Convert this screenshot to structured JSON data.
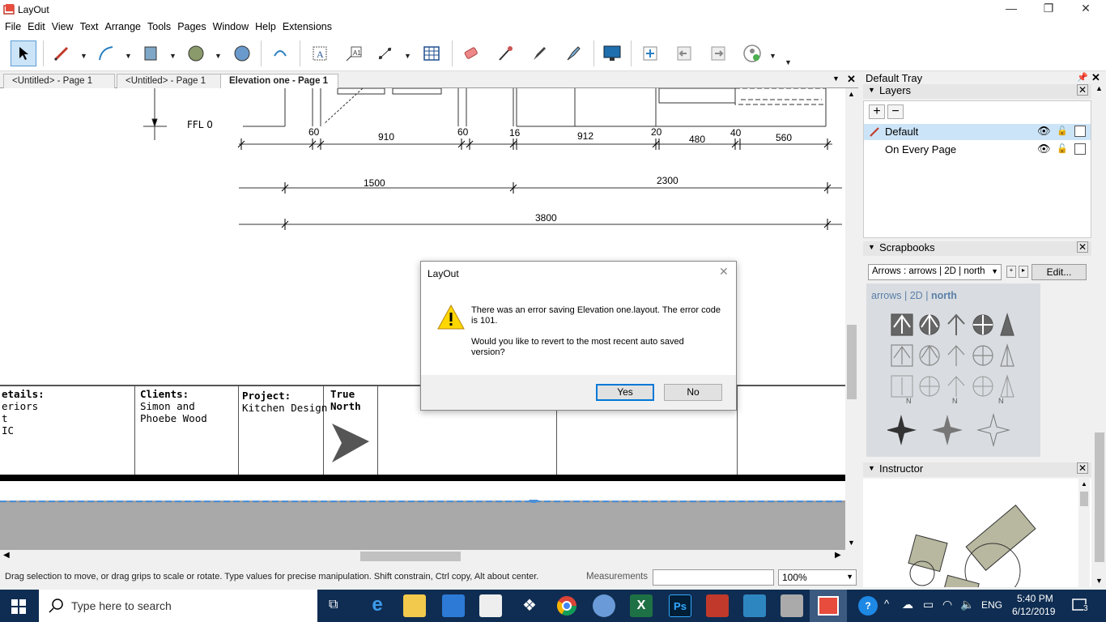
{
  "window": {
    "title": "LayOut",
    "minimize": "—",
    "restore": "❐",
    "close": "✕"
  },
  "menu": [
    "File",
    "Edit",
    "View",
    "Text",
    "Arrange",
    "Tools",
    "Pages",
    "Window",
    "Help",
    "Extensions"
  ],
  "tabs": [
    {
      "label": "<Untitled> - Page 1",
      "active": false
    },
    {
      "label": "<Untitled> - Page 1",
      "active": false
    },
    {
      "label": "Elevation one - Page 1",
      "active": true
    }
  ],
  "drawing": {
    "ffl_label": "FFL 0",
    "dims_row1": [
      "60",
      "910",
      "60",
      "16",
      "912",
      "20",
      "480",
      "40",
      "560"
    ],
    "dims_row2": [
      "1500",
      "2300"
    ],
    "dims_row3": [
      "3800"
    ]
  },
  "titleblock": {
    "details_label": "etails:",
    "details_lines": [
      "eriors",
      "t",
      "IC"
    ],
    "clients_label": "Clients:",
    "clients_lines": [
      "Simon and",
      "Phoebe Wood"
    ],
    "project_label": "Project:",
    "project_value": "Kitchen Design",
    "north_label_1": "True",
    "north_label_2": "North"
  },
  "status": {
    "hint": "Drag selection to move, or drag grips to scale or rotate. Type values for precise manipulation. Shift constrain, Ctrl copy, Alt about center.",
    "measurements_label": "Measurements",
    "measurements_value": "",
    "zoom": "100%"
  },
  "tray": {
    "title": "Default Tray",
    "layers": {
      "header": "Layers",
      "add": "+",
      "remove": "−",
      "items": [
        "Default",
        "On Every Page"
      ]
    },
    "scrapbooks": {
      "header": "Scrapbooks",
      "selected": "Arrows : arrows | 2D | north",
      "edit_label": "Edit...",
      "crumb_1": "arrows",
      "crumb_2": "2D",
      "crumb_3": "north",
      "sep": "|",
      "compass_n": "N"
    },
    "instructor": {
      "header": "Instructor"
    }
  },
  "dialog": {
    "title": "LayOut",
    "message_1": "There was an error saving Elevation one.layout. The error code is 101.",
    "message_2": "Would you like to revert to the most recent auto saved version?",
    "yes": "Yes",
    "no": "No"
  },
  "taskbar": {
    "search_placeholder": "Type here to search",
    "lang": "ENG",
    "time": "5:40 PM",
    "date": "6/12/2019",
    "notifications": "3"
  },
  "colors": {
    "accent": "#0078d7",
    "taskbar": "#0f2d52",
    "layer_selected": "#cce4f7",
    "scrapbook_bg": "#d9dde1"
  }
}
